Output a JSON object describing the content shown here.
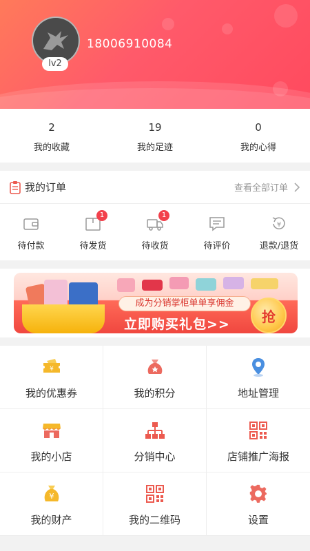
{
  "profile": {
    "level": "lv2",
    "phone": "18006910084"
  },
  "stats": [
    {
      "value": "2",
      "label": "我的收藏"
    },
    {
      "value": "19",
      "label": "我的足迹"
    },
    {
      "value": "0",
      "label": "我的心得"
    }
  ],
  "orders": {
    "title": "我的订单",
    "view_all": "查看全部订单",
    "items": [
      {
        "label": "待付款",
        "icon": "wallet-icon",
        "badge": ""
      },
      {
        "label": "待发货",
        "icon": "box-icon",
        "badge": "1"
      },
      {
        "label": "待收货",
        "icon": "truck-icon",
        "badge": "1"
      },
      {
        "label": "待评价",
        "icon": "comment-icon",
        "badge": ""
      },
      {
        "label": "退款/退货",
        "icon": "refund-icon",
        "badge": ""
      }
    ]
  },
  "banner": {
    "tagline": "成为分销掌柜单单享佣金",
    "cta": "立即购买礼包>>",
    "button": "抢"
  },
  "menu": [
    {
      "label": "我的优惠券",
      "icon": "coupon-icon"
    },
    {
      "label": "我的积分",
      "icon": "money-bag-icon"
    },
    {
      "label": "地址管理",
      "icon": "location-pin-icon"
    },
    {
      "label": "我的小店",
      "icon": "shop-icon"
    },
    {
      "label": "分销中心",
      "icon": "org-chart-icon"
    },
    {
      "label": "店铺推广海报",
      "icon": "qr-code-icon"
    },
    {
      "label": "我的财产",
      "icon": "yen-bag-icon"
    },
    {
      "label": "我的二维码",
      "icon": "qr-code-icon"
    },
    {
      "label": "设置",
      "icon": "gear-icon"
    }
  ],
  "colors": {
    "header_start": "#ff7a5a",
    "header_end": "#ff4a5e",
    "badge": "#f2414c",
    "icon_red": "#ec5a4f",
    "icon_gold": "#f5b82a",
    "icon_blue": "#4a8fe0"
  }
}
